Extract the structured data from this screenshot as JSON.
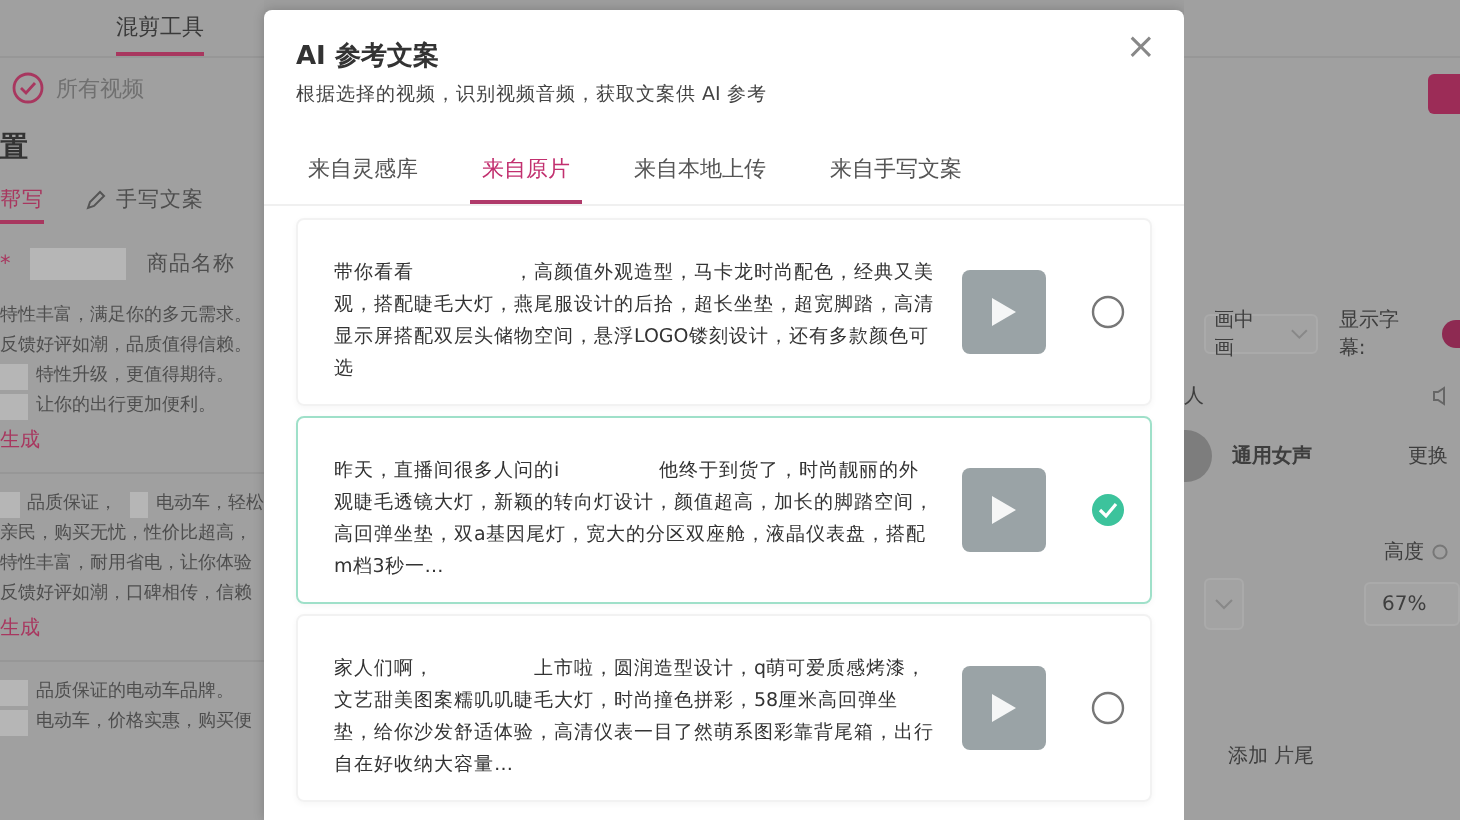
{
  "left_panel": {
    "top_tabs": [
      {
        "label": "混剪工具",
        "selected": true
      }
    ],
    "video_filter": {
      "label": "所有视频",
      "checked": true
    },
    "section_title": "置",
    "write_tabs": [
      {
        "label": "帮写",
        "selected": true,
        "kind": "plain"
      },
      {
        "label": "手写文案",
        "selected": false,
        "kind": "pencil"
      }
    ],
    "required_mark": "*",
    "product_label": "商品名称",
    "drafts": [
      {
        "lines": [
          {
            "text": "特性丰富，满足你的多元需求。",
            "blank_before": false
          },
          {
            "text": "反馈好评如潮，品质值得信赖。",
            "blank_before": false
          },
          {
            "text": "特性升级，更值得期待。",
            "blank_before": true
          },
          {
            "text": "让你的出行更加便利。",
            "blank_before": true
          }
        ],
        "action": "生成"
      },
      {
        "lines": [
          {
            "text": "品质保证，",
            "blank_before": true
          },
          {
            "text": "亲民，购买无忧，性价比超高，",
            "blank_before": false
          },
          {
            "text": "特性丰富，耐用省电，让你体验",
            "blank_before": false
          },
          {
            "text": "反馈好评如潮，口碑相传，信赖",
            "blank_before": false
          }
        ],
        "extra": "电动车，轻松",
        "action": "生成"
      },
      {
        "lines": [
          {
            "text": "品质保证的电动车品牌。",
            "blank_before": true
          },
          {
            "text": "电动车，价格实惠，购买便",
            "blank_before": true
          }
        ]
      }
    ]
  },
  "dialog": {
    "title": "AI 参考文案",
    "subtitle": "根据选择的视频，识别视频音频，获取文案供 AI 参考",
    "close": "×",
    "tabs": [
      {
        "label": "来自灵感库",
        "selected": false
      },
      {
        "label": "来自原片",
        "selected": true
      },
      {
        "label": "来自本地上传",
        "selected": false
      },
      {
        "label": "来自手写文案",
        "selected": false
      }
    ],
    "scripts": [
      {
        "text_parts": [
          "带你看看",
          "，高颜值外观造型，马卡龙时尚配色，经典又美观，搭配睫毛大灯，燕尾服设计的后拾，超长坐垫，超宽脚踏，高清显示屏搭配双层头储物空间，悬浮LOGO镂刻设计，还有多款颜色可选"
        ],
        "selected": false
      },
      {
        "text_parts": [
          "昨天，直播间很多人问的i",
          "他终于到货了，时尚靓丽的外观睫毛透镜大灯，新颖的转向灯设计，颜值超高，加长的脚踏空间，高回弹坐垫，双a基因尾灯，宽大的分区双座舱，液晶仪表盘，搭配m档3秒一…"
        ],
        "selected": true
      },
      {
        "text_parts": [
          "家人们啊，",
          "上市啦，圆润造型设计，q萌可爱质感烤漆，文艺甜美图案糯叽叽睫毛大灯，时尚撞色拼彩，58厘米高回弹坐垫，给你沙发舒适体验，高清仪表一目了然萌系图彩靠背尾箱，出行自在好收纳大容量…"
        ],
        "selected": false
      }
    ]
  },
  "right_panel": {
    "layout_select": "画中画",
    "subtitle_label": "显示字幕:",
    "subtitles_on": true,
    "voice_section": "人",
    "voice_name": "通用女声",
    "change_voice": "更换",
    "height_label": "高度",
    "height_value": "67%",
    "add_ending": "添加 片尾"
  }
}
